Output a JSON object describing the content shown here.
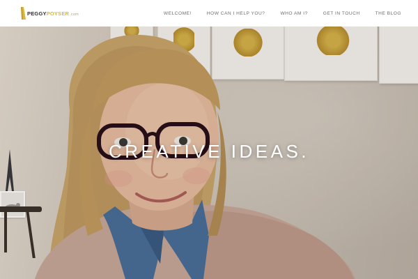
{
  "brand": {
    "logo_part1": "PEGGY",
    "logo_part2": "POYSER",
    "logo_suffix": ".com",
    "colors": {
      "dark": "#2f2f2f",
      "gold": "#d8b93a"
    }
  },
  "nav": {
    "items": [
      {
        "label": "WELCOME!"
      },
      {
        "label": "HOW CAN I HELP YOU?"
      },
      {
        "label": "WHO AM I?"
      },
      {
        "label": "GET IN TOUCH"
      },
      {
        "label": "THE BLOG"
      }
    ]
  },
  "hero": {
    "headline": "CREATIVE IDEAS."
  }
}
